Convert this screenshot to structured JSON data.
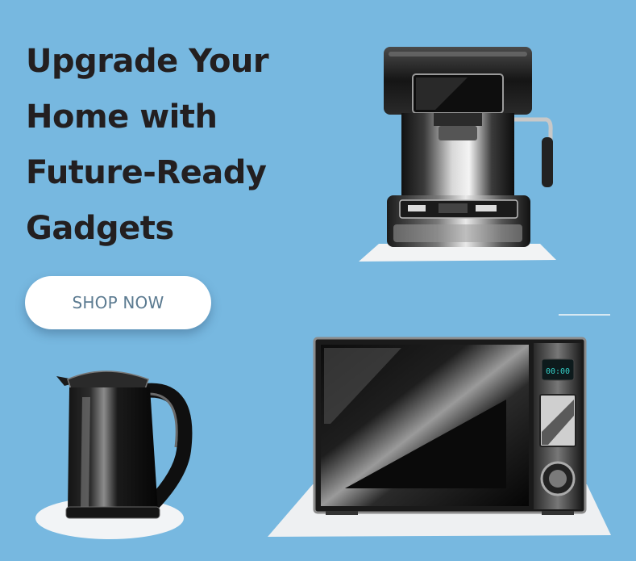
{
  "banner": {
    "background_color": "#77b8e0",
    "headline_lines": [
      "Upgrade Your",
      "Home with",
      "Future-Ready",
      "Gadgets"
    ],
    "cta_label": "SHOP NOW"
  },
  "products": [
    {
      "name": "coffee-machine",
      "icon": "coffee-machine-icon"
    },
    {
      "name": "microwave",
      "icon": "microwave-icon",
      "display_text": "00:00"
    },
    {
      "name": "electric-kettle",
      "icon": "kettle-icon"
    }
  ]
}
